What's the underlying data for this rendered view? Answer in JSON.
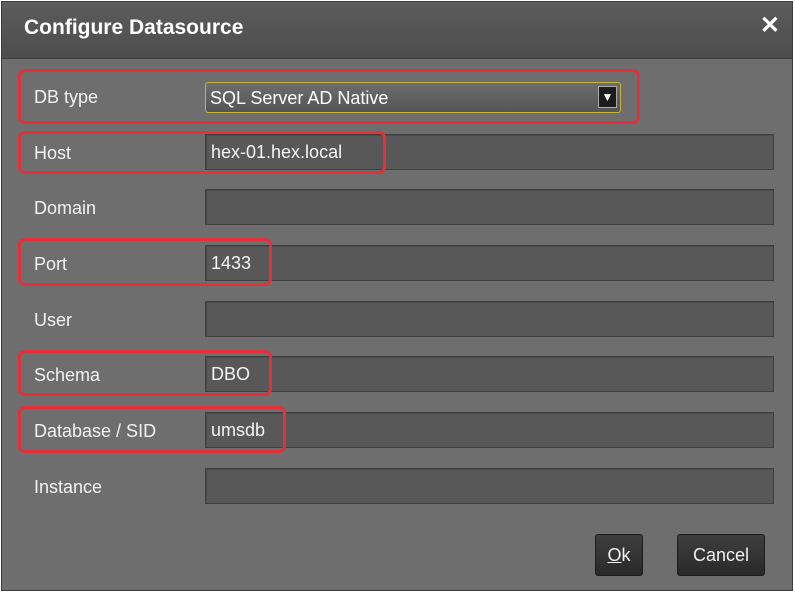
{
  "dialog": {
    "title": "Configure Datasource",
    "close_glyph": "✕"
  },
  "fields": {
    "db_type": {
      "label": "DB type",
      "value": "SQL Server AD Native",
      "arrow": "▼"
    },
    "host": {
      "label": "Host",
      "value": "hex-01.hex.local"
    },
    "domain": {
      "label": "Domain",
      "value": ""
    },
    "port": {
      "label": "Port",
      "value": "1433"
    },
    "user": {
      "label": "User",
      "value": ""
    },
    "schema": {
      "label": "Schema",
      "value": "DBO"
    },
    "database": {
      "label": "Database / SID",
      "value": "umsdb"
    },
    "instance": {
      "label": "Instance",
      "value": ""
    }
  },
  "buttons": {
    "ok_mnemonic": "O",
    "ok_rest": "k",
    "cancel": "Cancel"
  },
  "colors": {
    "highlight": "#e3303a",
    "dialog_bg": "#6e6e6e",
    "field_bg": "#585858",
    "select_border": "#c9b23a"
  }
}
